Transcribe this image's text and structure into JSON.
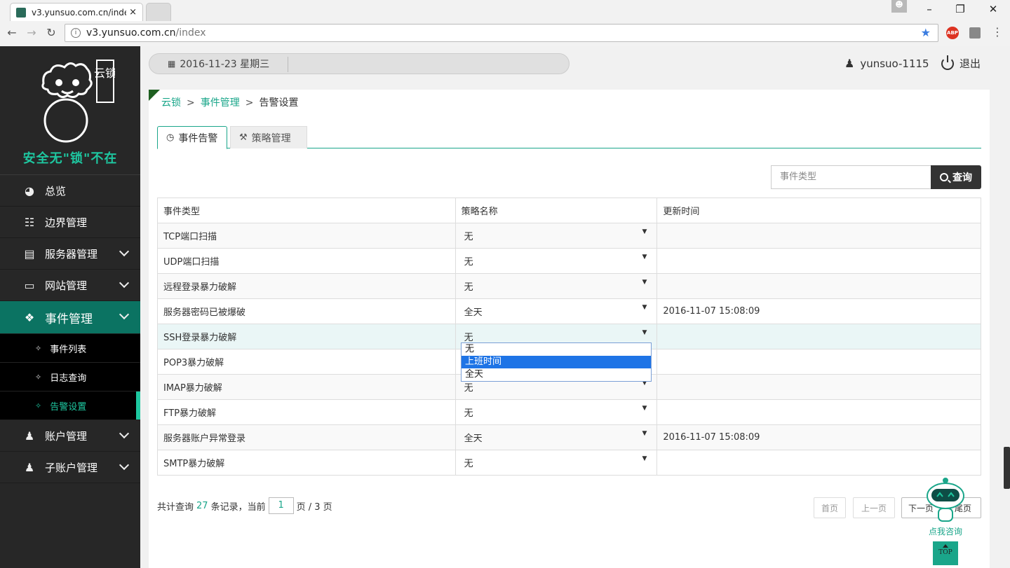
{
  "browser": {
    "tab_title": "v3.yunsuo.com.cn/inde",
    "tab_close": "×",
    "url_host": "v3.yunsuo.com.cn",
    "url_path": "/index",
    "abp_label": "ABP",
    "icons": [
      "back-icon",
      "forward-icon",
      "reload-icon",
      "info-icon",
      "star-icon",
      "abp-icon",
      "extension-icon",
      "menu-icon"
    ]
  },
  "sidebar": {
    "logo_text": "云锁",
    "slogan": "安全无\"锁\"不在",
    "items": [
      {
        "label": "总览",
        "icon": "pie-chart-icon",
        "expandable": false
      },
      {
        "label": "边界管理",
        "icon": "sitemap-icon",
        "expandable": false
      },
      {
        "label": "服务器管理",
        "icon": "server-icon",
        "expandable": true
      },
      {
        "label": "网站管理",
        "icon": "monitor-icon",
        "expandable": true
      },
      {
        "label": "事件管理",
        "icon": "tags-icon",
        "expandable": true,
        "active": true
      },
      {
        "label": "账户管理",
        "icon": "user-icon",
        "expandable": true
      },
      {
        "label": "子账户管理",
        "icon": "users-icon",
        "expandable": true
      }
    ],
    "sub_items": [
      {
        "label": "事件列表"
      },
      {
        "label": "日志查询"
      },
      {
        "label": "告警设置",
        "current": true
      }
    ]
  },
  "topbar": {
    "date": "2016-11-23 星期三",
    "username": "yunsuo-1115",
    "logout": "退出"
  },
  "breadcrumb": {
    "root": "云锁",
    "parent": "事件管理",
    "current": "告警设置",
    "separator": ">"
  },
  "tabs": [
    {
      "label": "事件告警",
      "icon": "clock-icon",
      "active": true
    },
    {
      "label": "策略管理",
      "icon": "wrench-icon",
      "active": false
    }
  ],
  "search": {
    "placeholder": "事件类型",
    "button": "查询"
  },
  "table": {
    "columns": [
      "事件类型",
      "策略名称",
      "更新时间"
    ],
    "rows": [
      {
        "type": "TCP端口扫描",
        "policy": "无",
        "time": ""
      },
      {
        "type": "UDP端口扫描",
        "policy": "无",
        "time": ""
      },
      {
        "type": "远程登录暴力破解",
        "policy": "无",
        "time": ""
      },
      {
        "type": "服务器密码已被爆破",
        "policy": "全天",
        "time": "2016-11-07 15:08:09"
      },
      {
        "type": "SSH登录暴力破解",
        "policy": "无",
        "time": ""
      },
      {
        "type": "POP3暴力破解",
        "policy": "",
        "time": ""
      },
      {
        "type": "IMAP暴力破解",
        "policy": "无",
        "time": ""
      },
      {
        "type": "FTP暴力破解",
        "policy": "无",
        "time": ""
      },
      {
        "type": "服务器账户异常登录",
        "policy": "全天",
        "time": "2016-11-07 15:08:09"
      },
      {
        "type": "SMTP暴力破解",
        "policy": "无",
        "time": ""
      }
    ]
  },
  "dropdown": {
    "options": [
      "无",
      "上班时间",
      "全天"
    ],
    "highlighted": "上班时间"
  },
  "pager": {
    "prefix": "共计查询",
    "total": "27",
    "records_current": "条记录，当前",
    "page": "1",
    "suffix": "页 / 3 页",
    "first": "首页",
    "prev": "上一页",
    "next": "下一页",
    "last": "尾页"
  },
  "widget": {
    "consult": "点我咨询",
    "top": "TOP"
  },
  "colors": {
    "accent": "#1aa68a",
    "sidebar_bg": "#272727",
    "active_nav": "#0b7362",
    "dropdown_highlight": "#1e74e6"
  }
}
